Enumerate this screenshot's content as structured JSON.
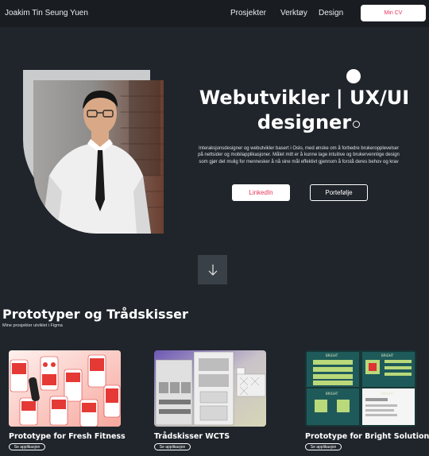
{
  "nav": {
    "brand": "Joakim Tin Seung Yuen",
    "links": [
      "Prosjekter",
      "Verktøy",
      "Design"
    ],
    "cv_button": "Min CV"
  },
  "hero": {
    "title_line1": "Webutvikler | UX/UI",
    "title_line2": "designer",
    "description": "Interaksjonsdesigner og webutvikler basert i Oslo, med ønske om å forbedre brukeropplevelser på nettsider og mobilapplikasjoner. Målet mitt er å kunne lage intuitive og brukervennlige design som gjør det mulig for mennesker å nå sine mål effektivt gjennom å forstå deres behov og krav",
    "linkedin_button": "LinkedIn",
    "portfolio_button": "Portefølje"
  },
  "section": {
    "title": "Prototyper og Trådskisser",
    "subtitle": "Mine prosjekter utviklet i Figma"
  },
  "cards": [
    {
      "title": "Prototype for Fresh Fitness",
      "button": "Se applikasjon"
    },
    {
      "title": "Trådskisser WCTS",
      "button": "Se applikasjon"
    },
    {
      "title": "Prototype for Bright Solutions",
      "button": "Se applikasjon"
    }
  ],
  "card3_header": "BRIGHT",
  "colors": {
    "background": "#1f252b",
    "navbar": "#191d22",
    "accent": "#e8345a",
    "fresh_fitness": "#e53935",
    "bright_teal": "#1f5a5a",
    "bright_green": "#b9d97a"
  },
  "icons": {
    "scroll": "arrow-down-icon"
  }
}
